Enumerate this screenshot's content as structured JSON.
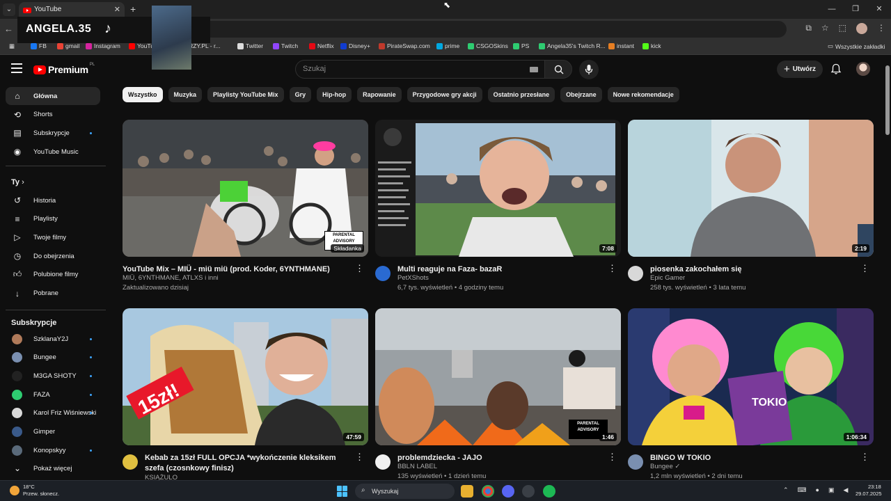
{
  "browser": {
    "tab_title": "YouTube",
    "bookmarks": [
      {
        "label": "FB",
        "color": "#1877f2"
      },
      {
        "label": "gmail",
        "color": "#ea4335"
      },
      {
        "label": "Instagram",
        "color": "#d6249f"
      },
      {
        "label": "YouTu",
        "color": "#ff0000"
      },
      {
        "label": "STREAMERZY.PL - r...",
        "color": "#888888"
      },
      {
        "label": "Twitter",
        "color": "#dddddd"
      },
      {
        "label": "Twitch",
        "color": "#9146ff"
      },
      {
        "label": "Netflix",
        "color": "#e50914"
      },
      {
        "label": "Disney+",
        "color": "#113ccf"
      },
      {
        "label": "PirateSwap.com",
        "color": "#c0392b"
      },
      {
        "label": "prime",
        "color": "#00a8e1"
      },
      {
        "label": "CSGOSkins",
        "color": "#2ecc71"
      },
      {
        "label": "PS",
        "color": "#2ecc71"
      },
      {
        "label": "Angela35's Twitch R...",
        "color": "#2ecc71"
      },
      {
        "label": "instant",
        "color": "#e67e22"
      },
      {
        "label": "kick",
        "color": "#53fc18"
      }
    ],
    "all_bookmarks": "Wszystkie zakładki"
  },
  "overlay": {
    "streamer": "ANGELA.35"
  },
  "masthead": {
    "logo_text": "Premium",
    "logo_region": "PL",
    "search_placeholder": "Szukaj",
    "create_label": "Utwórz"
  },
  "sidebar": {
    "main": [
      {
        "label": "Główna",
        "icon": "home-icon",
        "active": true
      },
      {
        "label": "Shorts",
        "icon": "shorts-icon"
      },
      {
        "label": "Subskrypcje",
        "icon": "subscriptions-icon",
        "dot": true
      },
      {
        "label": "YouTube Music",
        "icon": "youtube-music-icon"
      }
    ],
    "you_heading": "Ty",
    "you": [
      {
        "label": "Historia",
        "icon": "history-icon"
      },
      {
        "label": "Playlisty",
        "icon": "playlists-icon"
      },
      {
        "label": "Twoje filmy",
        "icon": "your-videos-icon"
      },
      {
        "label": "Do obejrzenia",
        "icon": "watch-later-icon"
      },
      {
        "label": "Polubione filmy",
        "icon": "liked-icon"
      },
      {
        "label": "Pobrane",
        "icon": "download-icon"
      }
    ],
    "subs_heading": "Subskrypcje",
    "subs": [
      {
        "label": "SzklanaY2J",
        "color": "#b07a5a",
        "dot": true
      },
      {
        "label": "Bungee",
        "color": "#7a8fb0",
        "dot": true
      },
      {
        "label": "M3GA SHOTY",
        "color": "#222222",
        "dot": true
      },
      {
        "label": "FAZA",
        "color": "#2ecc71",
        "dot": true
      },
      {
        "label": "Karol Friz Wiśniewski",
        "color": "#d9d9d9",
        "dot": true
      },
      {
        "label": "Gimper",
        "color": "#3a5a8a",
        "dot": false
      },
      {
        "label": "Konopskyy",
        "color": "#5a6a7a",
        "dot": true
      }
    ],
    "show_more": "Pokaż więcej"
  },
  "chips": [
    "Wszystko",
    "Muzyka",
    "Playlisty YouTube Mix",
    "Gry",
    "Hip-hop",
    "Rapowanie",
    "Przygodowe gry akcji",
    "Ostatnio przesłane",
    "Obejrzane",
    "Nowe rekomendacje"
  ],
  "videos": [
    {
      "title": "YouTube Mix – MIÜ - miü miü (prod. Koder, 6YNTHMANE)",
      "channel": "MIÜ, 6YNTHMANE, ATLXS i inni",
      "stats": "Zaktualizowano dzisiaj",
      "badge": "Składanka"
    },
    {
      "title": "Multi reaguje na Faza- bazaR",
      "channel": "PetXShots",
      "stats": "6,7 tys. wyświetleń • 4 godziny temu",
      "duration": "7:08"
    },
    {
      "title": "piosenka zakochałem się",
      "channel": "Epic Gamer",
      "stats": "258 tys. wyświetleń • 3 lata temu",
      "duration": "2:19"
    },
    {
      "title": "Kebab za 15zł FULL OPCJA *wykończenie kleksikem szefa (czosnkowy finisz)",
      "channel": "KSIĄŻULO",
      "stats": "",
      "duration": "47:59",
      "thumb_text": "15zł!"
    },
    {
      "title": "problemdziecka - JAJO",
      "channel": "BBLN LABEL",
      "stats": "135 wyświetleń • 1 dzień temu",
      "duration": "1:46"
    },
    {
      "title": "BINGO W TOKIO",
      "channel": "Bungee",
      "stats": "1,2 mln wyświetleń • 2 dni temu",
      "duration": "1:06:34",
      "thumb_text": "TOKIO"
    }
  ],
  "taskbar": {
    "temp": "18°C",
    "weather": "Przew. słonecz.",
    "search": "Wyszukaj",
    "time": "23:18",
    "date": "29.07.2025"
  }
}
